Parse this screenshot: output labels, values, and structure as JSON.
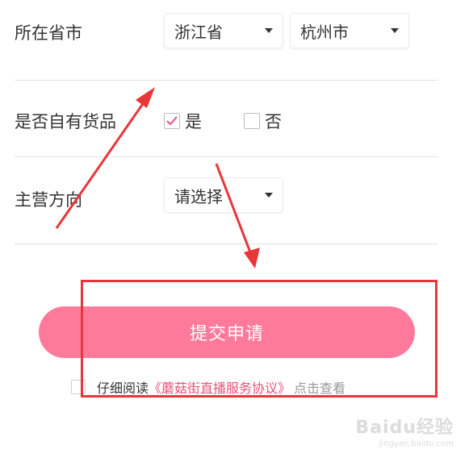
{
  "form": {
    "province_city": {
      "label": "所在省市",
      "province": "浙江省",
      "city": "杭州市"
    },
    "own_goods": {
      "label": "是否自有货品",
      "yes": "是",
      "no": "否",
      "selected": "是"
    },
    "main_direction": {
      "label": "主营方向",
      "value": "请选择"
    }
  },
  "submit": {
    "label": "提交申请"
  },
  "agreement": {
    "prefix": "仔细阅读",
    "link": "《蘑菇街直播服务协议》",
    "suffix": "点击查看"
  },
  "colors": {
    "accent": "#ff7a9a",
    "link": "#e8507a",
    "annotation": "#e8363a",
    "check": "#e8507a"
  },
  "watermark": {
    "main": "Baidu经验",
    "sub": "jingyan.baidu.com"
  }
}
